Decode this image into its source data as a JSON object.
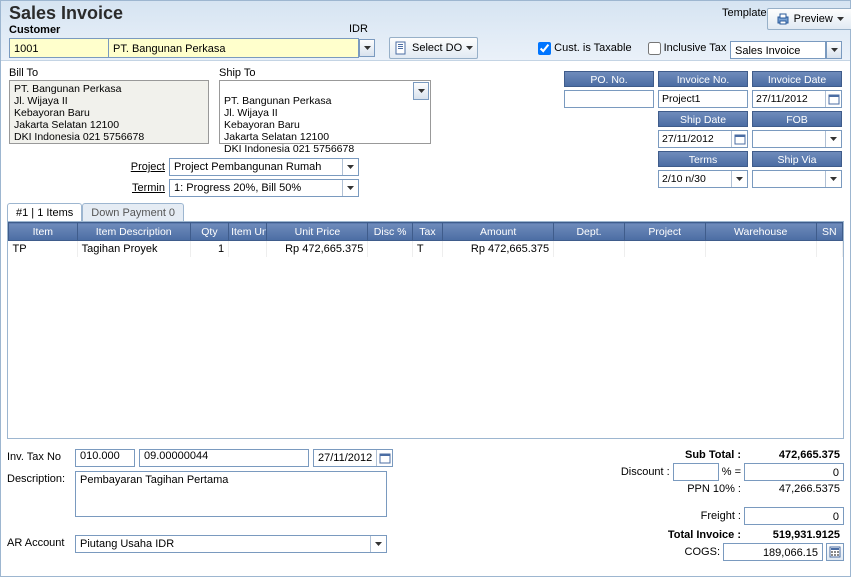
{
  "title": "Sales Invoice",
  "customer_label": "Customer",
  "currency_label": "IDR",
  "customer_code": "1001",
  "customer_name": "PT. Bangunan Perkasa",
  "select_do_label": "Select DO",
  "cust_taxable_label": "Cust. is Taxable",
  "cust_taxable_checked": true,
  "inclusive_tax_label": "Inclusive Tax",
  "inclusive_tax_checked": false,
  "template_label": "Template",
  "preview_label": "Preview",
  "template_value": "Sales Invoice",
  "bill_to_label": "Bill To",
  "ship_to_label": "Ship To",
  "bill_to_address": "PT. Bangunan Perkasa\nJl. Wijaya II\nKebayoran Baru\nJakarta Selatan 12100\nDKI Indonesia 021 5756678",
  "ship_to_address": "PT. Bangunan Perkasa\nJl. Wijaya II\nKebayoran Baru\nJakarta Selatan 12100\nDKI Indonesia 021 5756678",
  "right": {
    "po_no_label": "PO. No.",
    "po_no": "",
    "invoice_no_label": "Invoice No.",
    "invoice_no": "Project1",
    "invoice_date_label": "Invoice Date",
    "invoice_date": "27/11/2012",
    "ship_date_label": "Ship Date",
    "ship_date": "27/11/2012",
    "fob_label": "FOB",
    "fob": "",
    "terms_label": "Terms",
    "terms": "2/10 n/30",
    "ship_via_label": "Ship Via",
    "ship_via": ""
  },
  "project_label": "Project",
  "project_value": "Project Pembangunan Rumah",
  "termin_label": "Termin",
  "termin_value": "1: Progress  20%, Bill  50%",
  "tabs": {
    "items_label": "#1 | 1 Items",
    "dp_label": "Down Payment   0"
  },
  "grid": {
    "headers": [
      "Item",
      "Item Description",
      "Qty",
      "Item Un",
      "Unit Price",
      "Disc %",
      "Tax",
      "Amount",
      "Dept.",
      "Project",
      "Warehouse",
      "SN"
    ],
    "row": {
      "item": "TP",
      "desc": "Tagihan Proyek",
      "qty": "1",
      "unit": "",
      "unit_price": "Rp 472,665.375",
      "disc": "",
      "tax": "T",
      "amount": "Rp 472,665.375",
      "dept": "",
      "project": "",
      "warehouse": "",
      "sn": ""
    }
  },
  "inv_tax_no_label": "Inv. Tax No",
  "inv_tax_a": "010.000",
  "inv_tax_b": "09.00000044",
  "inv_tax_date": "27/11/2012",
  "description_label": "Description:",
  "description_value": "Pembayaran Tagihan Pertama",
  "ar_account_label": "AR Account",
  "ar_account_value": "Piutang Usaha IDR",
  "totals": {
    "sub_total_label": "Sub Total :",
    "sub_total": "472,665.375",
    "discount_label": "Discount :",
    "discount_pct": "",
    "pct_sign": "% =",
    "discount_amt": "0",
    "ppn_label": "PPN 10% :",
    "ppn": "47,266.5375",
    "freight_label": "Freight :",
    "freight": "0",
    "total_invoice_label": "Total Invoice :",
    "total_invoice": "519,931.9125",
    "cogs_label": "COGS:",
    "cogs": "189,066.15"
  }
}
